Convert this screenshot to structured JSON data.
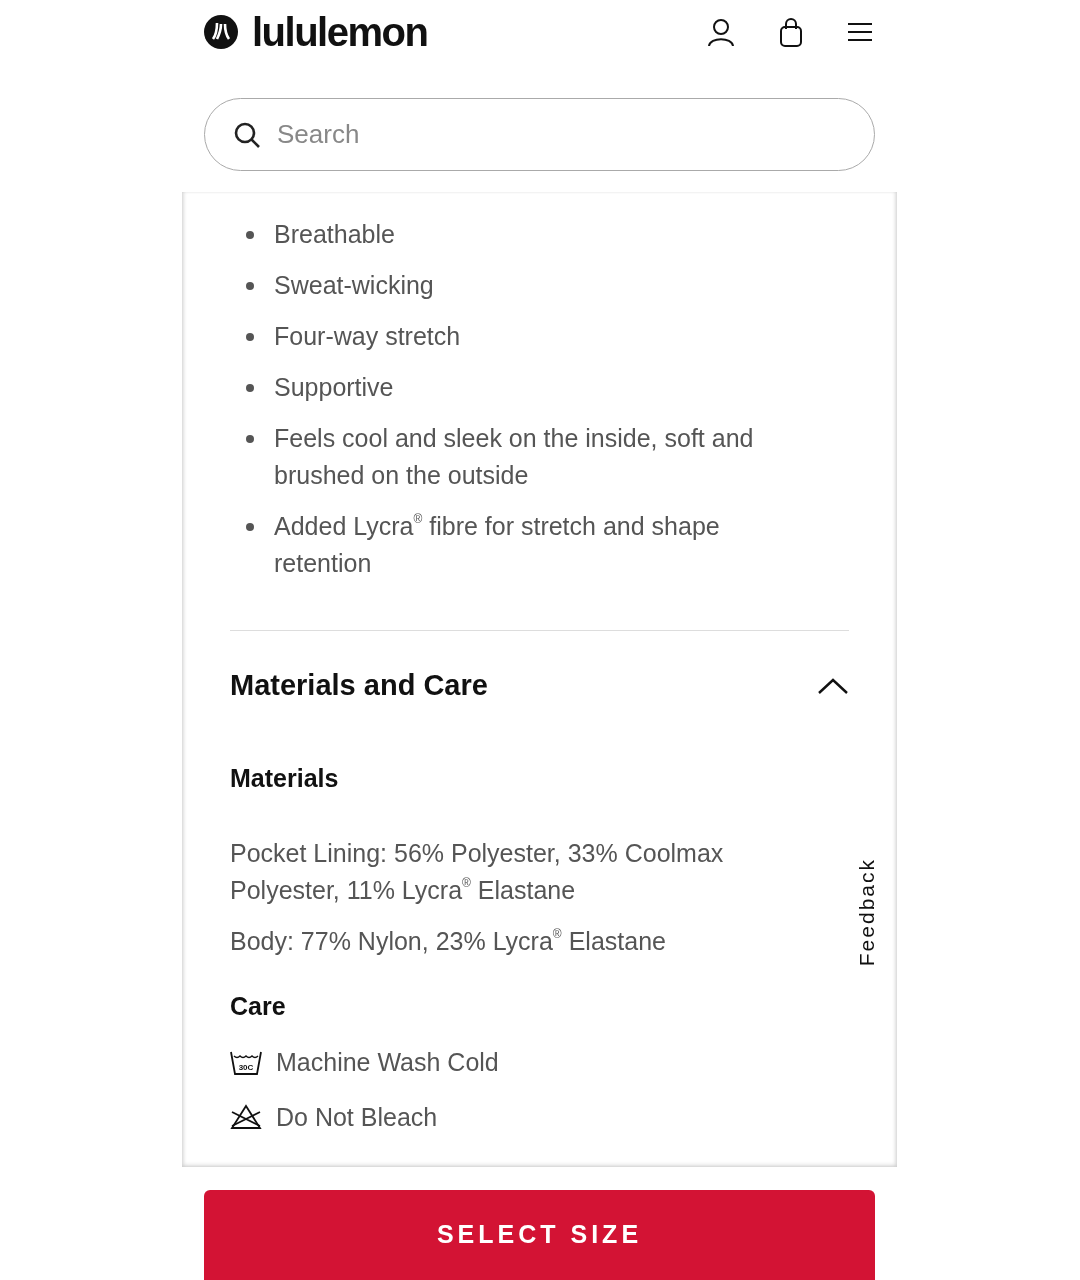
{
  "header": {
    "logo_text": "lululemon"
  },
  "search": {
    "placeholder": "Search"
  },
  "features": [
    "Breathable",
    "Sweat-wicking",
    "Four-way stretch",
    "Supportive",
    "Feels cool and sleek on the inside, soft and brushed on the outside",
    "Added Lycra$^{®}$ fibre for stretch and shape retention"
  ],
  "section": {
    "title": "Materials and Care",
    "expanded": true
  },
  "materials": {
    "heading": "Materials",
    "lines": [
      "Pocket Lining: 56% Polyester, 33% Coolmax Polyester, 11% Lycra$^{®}$ Elastane",
      "Body: 77% Nylon, 23% Lycra$^{®}$ Elastane"
    ]
  },
  "care": {
    "heading": "Care",
    "items": [
      {
        "kind": "wash",
        "icon_label": "30C",
        "text": "Machine Wash Cold"
      },
      {
        "kind": "no-bleach",
        "text": "Do Not Bleach"
      }
    ]
  },
  "feedback": {
    "label": "Feedback"
  },
  "cta": {
    "label": "SELECT SIZE"
  }
}
